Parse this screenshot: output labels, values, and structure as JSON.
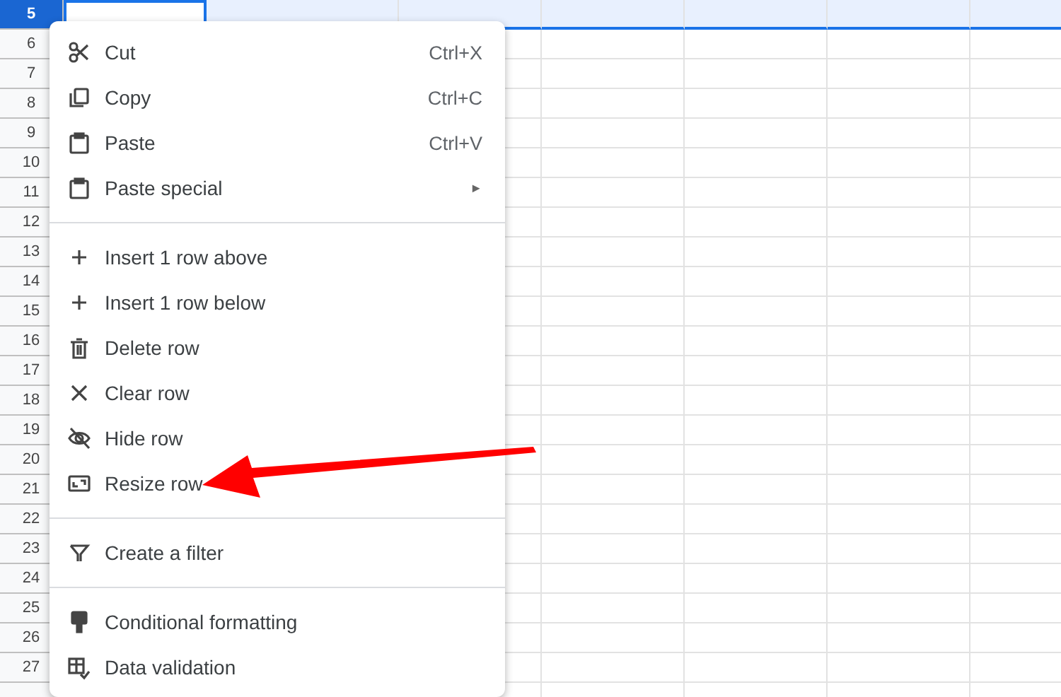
{
  "sheet": {
    "rows": [
      {
        "label": "5",
        "selected": true
      },
      {
        "label": "6",
        "selected": false
      },
      {
        "label": "7",
        "selected": false
      },
      {
        "label": "8",
        "selected": false
      },
      {
        "label": "9",
        "selected": false
      },
      {
        "label": "10",
        "selected": false
      },
      {
        "label": "11",
        "selected": false
      },
      {
        "label": "12",
        "selected": false
      },
      {
        "label": "13",
        "selected": false
      },
      {
        "label": "14",
        "selected": false
      },
      {
        "label": "15",
        "selected": false
      },
      {
        "label": "16",
        "selected": false
      },
      {
        "label": "17",
        "selected": false
      },
      {
        "label": "18",
        "selected": false
      },
      {
        "label": "19",
        "selected": false
      },
      {
        "label": "20",
        "selected": false
      },
      {
        "label": "21",
        "selected": false
      },
      {
        "label": "22",
        "selected": false
      },
      {
        "label": "23",
        "selected": false
      },
      {
        "label": "24",
        "selected": false
      },
      {
        "label": "25",
        "selected": false
      },
      {
        "label": "26",
        "selected": false
      },
      {
        "label": "27",
        "selected": false
      }
    ]
  },
  "context_menu": {
    "groups": [
      [
        {
          "label": "Cut",
          "shortcut": "Ctrl+X"
        },
        {
          "label": "Copy",
          "shortcut": "Ctrl+C"
        },
        {
          "label": "Paste",
          "shortcut": "Ctrl+V"
        },
        {
          "label": "Paste special",
          "submenu": "►"
        }
      ],
      [
        {
          "label": "Insert 1 row above"
        },
        {
          "label": "Insert 1 row below"
        },
        {
          "label": "Delete row"
        },
        {
          "label": "Clear row"
        },
        {
          "label": "Hide row"
        },
        {
          "label": "Resize row"
        }
      ],
      [
        {
          "label": "Create a filter"
        }
      ],
      [
        {
          "label": "Conditional formatting"
        },
        {
          "label": "Data validation"
        }
      ]
    ]
  }
}
